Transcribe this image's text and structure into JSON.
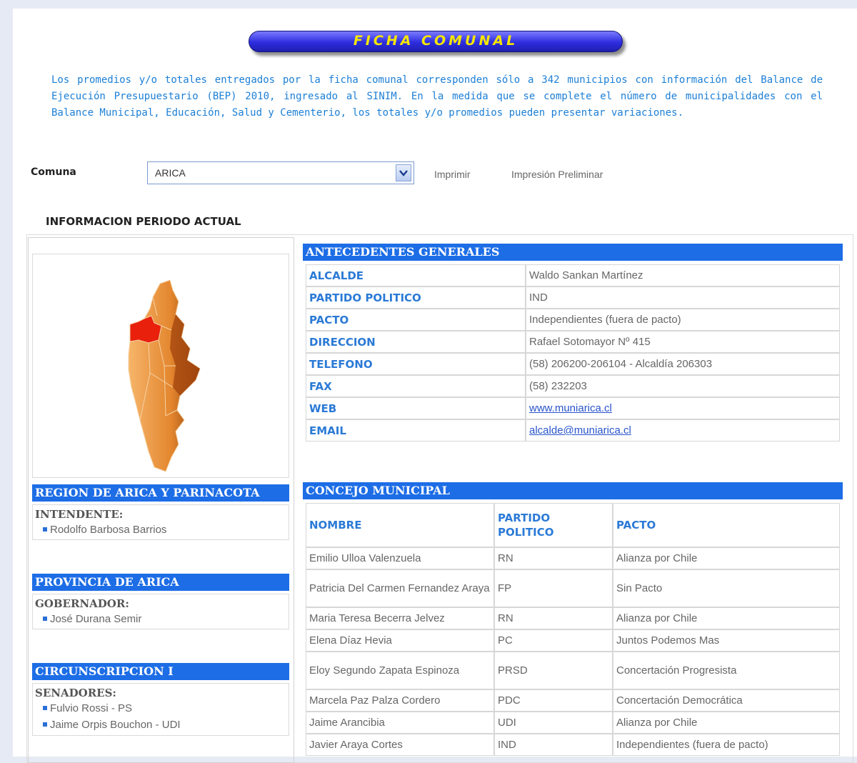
{
  "header": {
    "title": "FICHA COMUNAL"
  },
  "intro": "Los promedios y/o totales entregados por la ficha comunal corresponden sólo a 342 municipios con información del Balance de Ejecución Presupuestario (BEP) 2010, ingresado al SINIM. En la medida que se complete el número de municipalidades con el Balance Municipal, Educación, Salud y Cementerio, los totales y/o promedios pueden presentar variaciones.",
  "selector": {
    "label": "Comuna",
    "value": "ARICA"
  },
  "actions": {
    "print": "Imprimir",
    "preview": "Impresión Preliminar"
  },
  "section_title": "INFORMACION PERIODO ACTUAL",
  "region": {
    "title": "REGION DE ARICA Y PARINACOTA",
    "role": "INTENDENTE:",
    "items": [
      "Rodolfo Barbosa Barrios"
    ]
  },
  "provincia": {
    "title": "PROVINCIA DE ARICA",
    "role": "GOBERNADOR:",
    "items": [
      "José Durana Semir"
    ]
  },
  "circunscripcion": {
    "title": "CIRCUNSCRIPCION I",
    "role": "SENADORES:",
    "items": [
      "Fulvio Rossi - PS",
      "Jaime Orpis Bouchon - UDI"
    ]
  },
  "antecedentes": {
    "title": "ANTECEDENTES GENERALES",
    "rows": [
      {
        "label": "ALCALDE",
        "value": "Waldo Sankan Martínez"
      },
      {
        "label": "PARTIDO POLITICO",
        "value": "IND"
      },
      {
        "label": "PACTO",
        "value": "Independientes (fuera de pacto)"
      },
      {
        "label": "DIRECCION",
        "value": "Rafael Sotomayor Nº 415"
      },
      {
        "label": "TELEFONO",
        "value": "(58) 206200-206104 - Alcaldía 206303"
      },
      {
        "label": "FAX",
        "value": "(58) 232203"
      },
      {
        "label": "WEB",
        "value": "www.muniarica.cl"
      },
      {
        "label": "EMAIL",
        "value": "alcalde@muniarica.cl"
      }
    ]
  },
  "concejo": {
    "title": "CONCEJO MUNICIPAL",
    "headers": {
      "nombre": "NOMBRE",
      "partido": "PARTIDO POLITICO",
      "pacto": "PACTO"
    },
    "rows": [
      {
        "nombre": "Emilio Ulloa Valenzuela",
        "partido": "RN",
        "pacto": "Alianza por Chile"
      },
      {
        "nombre": "Patricia Del Carmen Fernandez Araya",
        "partido": "FP",
        "pacto": "Sin Pacto"
      },
      {
        "nombre": "Maria Teresa Becerra Jelvez",
        "partido": "RN",
        "pacto": "Alianza por Chile"
      },
      {
        "nombre": "Elena Díaz Hevia",
        "partido": "PC",
        "pacto": "Juntos Podemos Mas"
      },
      {
        "nombre": "Eloy Segundo Zapata Espinoza",
        "partido": "PRSD",
        "pacto": "Concertación Progresista"
      },
      {
        "nombre": "Marcela Paz Palza Cordero",
        "partido": "PDC",
        "pacto": "Concertación Democrática"
      },
      {
        "nombre": "Jaime Arancibia",
        "partido": "UDI",
        "pacto": "Alianza por Chile"
      },
      {
        "nombre": "Javier Araya Cortes",
        "partido": "IND",
        "pacto": "Independientes (fuera de pacto)"
      }
    ]
  },
  "colors": {
    "bar": "#1d6de6",
    "label": "#2b7ad6",
    "intro": "#1c7fd6",
    "title_text": "#f6e600",
    "map_highlight": "#e8200c"
  },
  "icons": {
    "dropdown": "chevron-down-icon",
    "bullet": "square-bullet-icon"
  }
}
